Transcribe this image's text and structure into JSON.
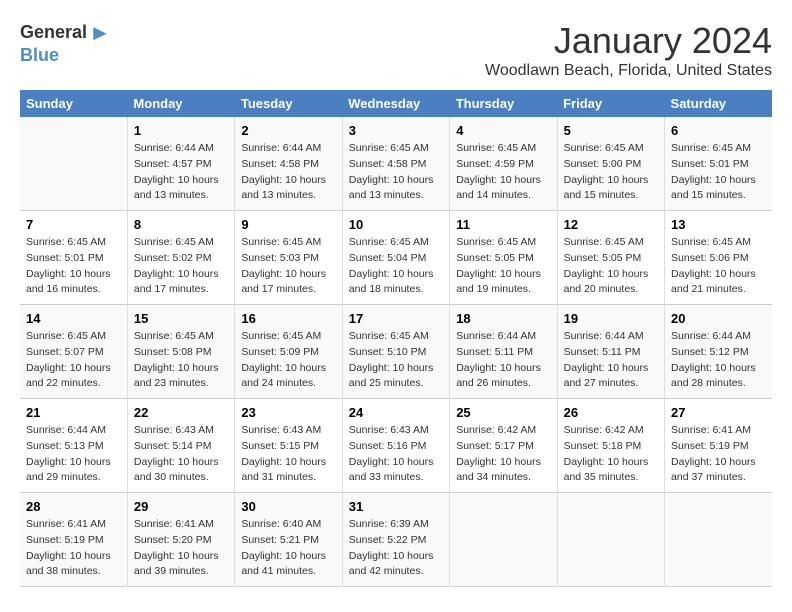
{
  "logo": {
    "general": "General",
    "blue": "Blue",
    "arrow": "▶"
  },
  "title": "January 2024",
  "location": "Woodlawn Beach, Florida, United States",
  "headers": [
    "Sunday",
    "Monday",
    "Tuesday",
    "Wednesday",
    "Thursday",
    "Friday",
    "Saturday"
  ],
  "weeks": [
    [
      {
        "day": "",
        "info": ""
      },
      {
        "day": "1",
        "info": "Sunrise: 6:44 AM\nSunset: 4:57 PM\nDaylight: 10 hours\nand 13 minutes."
      },
      {
        "day": "2",
        "info": "Sunrise: 6:44 AM\nSunset: 4:58 PM\nDaylight: 10 hours\nand 13 minutes."
      },
      {
        "day": "3",
        "info": "Sunrise: 6:45 AM\nSunset: 4:58 PM\nDaylight: 10 hours\nand 13 minutes."
      },
      {
        "day": "4",
        "info": "Sunrise: 6:45 AM\nSunset: 4:59 PM\nDaylight: 10 hours\nand 14 minutes."
      },
      {
        "day": "5",
        "info": "Sunrise: 6:45 AM\nSunset: 5:00 PM\nDaylight: 10 hours\nand 15 minutes."
      },
      {
        "day": "6",
        "info": "Sunrise: 6:45 AM\nSunset: 5:01 PM\nDaylight: 10 hours\nand 15 minutes."
      }
    ],
    [
      {
        "day": "7",
        "info": "Sunrise: 6:45 AM\nSunset: 5:01 PM\nDaylight: 10 hours\nand 16 minutes."
      },
      {
        "day": "8",
        "info": "Sunrise: 6:45 AM\nSunset: 5:02 PM\nDaylight: 10 hours\nand 17 minutes."
      },
      {
        "day": "9",
        "info": "Sunrise: 6:45 AM\nSunset: 5:03 PM\nDaylight: 10 hours\nand 17 minutes."
      },
      {
        "day": "10",
        "info": "Sunrise: 6:45 AM\nSunset: 5:04 PM\nDaylight: 10 hours\nand 18 minutes."
      },
      {
        "day": "11",
        "info": "Sunrise: 6:45 AM\nSunset: 5:05 PM\nDaylight: 10 hours\nand 19 minutes."
      },
      {
        "day": "12",
        "info": "Sunrise: 6:45 AM\nSunset: 5:05 PM\nDaylight: 10 hours\nand 20 minutes."
      },
      {
        "day": "13",
        "info": "Sunrise: 6:45 AM\nSunset: 5:06 PM\nDaylight: 10 hours\nand 21 minutes."
      }
    ],
    [
      {
        "day": "14",
        "info": "Sunrise: 6:45 AM\nSunset: 5:07 PM\nDaylight: 10 hours\nand 22 minutes."
      },
      {
        "day": "15",
        "info": "Sunrise: 6:45 AM\nSunset: 5:08 PM\nDaylight: 10 hours\nand 23 minutes."
      },
      {
        "day": "16",
        "info": "Sunrise: 6:45 AM\nSunset: 5:09 PM\nDaylight: 10 hours\nand 24 minutes."
      },
      {
        "day": "17",
        "info": "Sunrise: 6:45 AM\nSunset: 5:10 PM\nDaylight: 10 hours\nand 25 minutes."
      },
      {
        "day": "18",
        "info": "Sunrise: 6:44 AM\nSunset: 5:11 PM\nDaylight: 10 hours\nand 26 minutes."
      },
      {
        "day": "19",
        "info": "Sunrise: 6:44 AM\nSunset: 5:11 PM\nDaylight: 10 hours\nand 27 minutes."
      },
      {
        "day": "20",
        "info": "Sunrise: 6:44 AM\nSunset: 5:12 PM\nDaylight: 10 hours\nand 28 minutes."
      }
    ],
    [
      {
        "day": "21",
        "info": "Sunrise: 6:44 AM\nSunset: 5:13 PM\nDaylight: 10 hours\nand 29 minutes."
      },
      {
        "day": "22",
        "info": "Sunrise: 6:43 AM\nSunset: 5:14 PM\nDaylight: 10 hours\nand 30 minutes."
      },
      {
        "day": "23",
        "info": "Sunrise: 6:43 AM\nSunset: 5:15 PM\nDaylight: 10 hours\nand 31 minutes."
      },
      {
        "day": "24",
        "info": "Sunrise: 6:43 AM\nSunset: 5:16 PM\nDaylight: 10 hours\nand 33 minutes."
      },
      {
        "day": "25",
        "info": "Sunrise: 6:42 AM\nSunset: 5:17 PM\nDaylight: 10 hours\nand 34 minutes."
      },
      {
        "day": "26",
        "info": "Sunrise: 6:42 AM\nSunset: 5:18 PM\nDaylight: 10 hours\nand 35 minutes."
      },
      {
        "day": "27",
        "info": "Sunrise: 6:41 AM\nSunset: 5:19 PM\nDaylight: 10 hours\nand 37 minutes."
      }
    ],
    [
      {
        "day": "28",
        "info": "Sunrise: 6:41 AM\nSunset: 5:19 PM\nDaylight: 10 hours\nand 38 minutes."
      },
      {
        "day": "29",
        "info": "Sunrise: 6:41 AM\nSunset: 5:20 PM\nDaylight: 10 hours\nand 39 minutes."
      },
      {
        "day": "30",
        "info": "Sunrise: 6:40 AM\nSunset: 5:21 PM\nDaylight: 10 hours\nand 41 minutes."
      },
      {
        "day": "31",
        "info": "Sunrise: 6:39 AM\nSunset: 5:22 PM\nDaylight: 10 hours\nand 42 minutes."
      },
      {
        "day": "",
        "info": ""
      },
      {
        "day": "",
        "info": ""
      },
      {
        "day": "",
        "info": ""
      }
    ]
  ]
}
